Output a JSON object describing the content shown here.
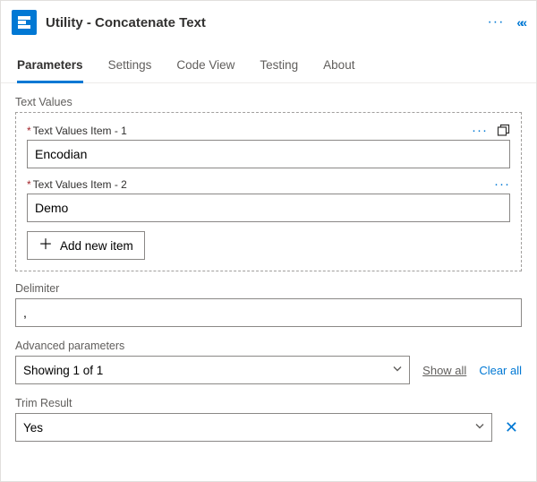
{
  "header": {
    "app_icon_glyph": "E",
    "title": "Utility - Concatenate Text"
  },
  "tabs": [
    {
      "label": "Parameters",
      "active": true
    },
    {
      "label": "Settings",
      "active": false
    },
    {
      "label": "Code View",
      "active": false
    },
    {
      "label": "Testing",
      "active": false
    },
    {
      "label": "About",
      "active": false
    }
  ],
  "textValues": {
    "section_label": "Text Values",
    "items": [
      {
        "label": "Text Values Item - 1",
        "value": "Encodian"
      },
      {
        "label": "Text Values Item - 2",
        "value": "Demo"
      }
    ],
    "add_button": "Add new item"
  },
  "delimiter": {
    "label": "Delimiter",
    "value": ","
  },
  "advanced": {
    "label": "Advanced parameters",
    "selected": "Showing 1 of 1",
    "show_all": "Show all",
    "clear_all": "Clear all"
  },
  "trim": {
    "label": "Trim Result",
    "value": "Yes"
  }
}
